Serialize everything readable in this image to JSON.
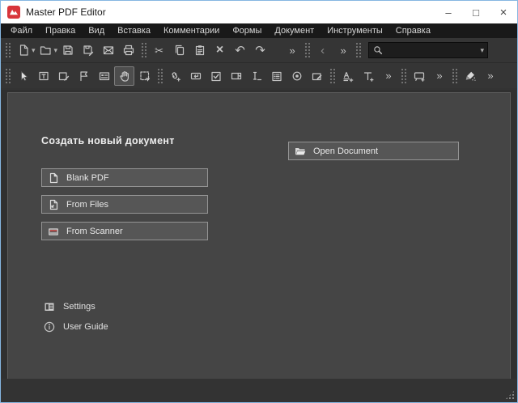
{
  "window": {
    "title": "Master PDF Editor",
    "controls": {
      "minimize": "–",
      "maximize": "□",
      "close": "×"
    }
  },
  "menu": {
    "items": [
      "Файл",
      "Правка",
      "Вид",
      "Вставка",
      "Комментарии",
      "Формы",
      "Документ",
      "Инструменты",
      "Справка"
    ]
  },
  "glyphs": {
    "caret_down": "▾",
    "chevron": "»",
    "back": "‹",
    "cut": "✂",
    "delete": "×",
    "undo": "↶",
    "redo": "↷"
  },
  "search": {
    "value": "",
    "placeholder": ""
  },
  "content": {
    "heading": "Создать новый документ",
    "buttons": {
      "blank_pdf": "Blank PDF",
      "from_files": "From Files",
      "from_scanner": "From Scanner",
      "open_document": "Open Document"
    },
    "links": {
      "settings": "Settings",
      "user_guide": "User Guide"
    }
  },
  "colors": {
    "logo_red": "#d8353b",
    "scanner_line": "#c0504d",
    "window_border": "#86b7e2",
    "toolbar_bg": "#353535",
    "panel_bg": "#454545"
  }
}
